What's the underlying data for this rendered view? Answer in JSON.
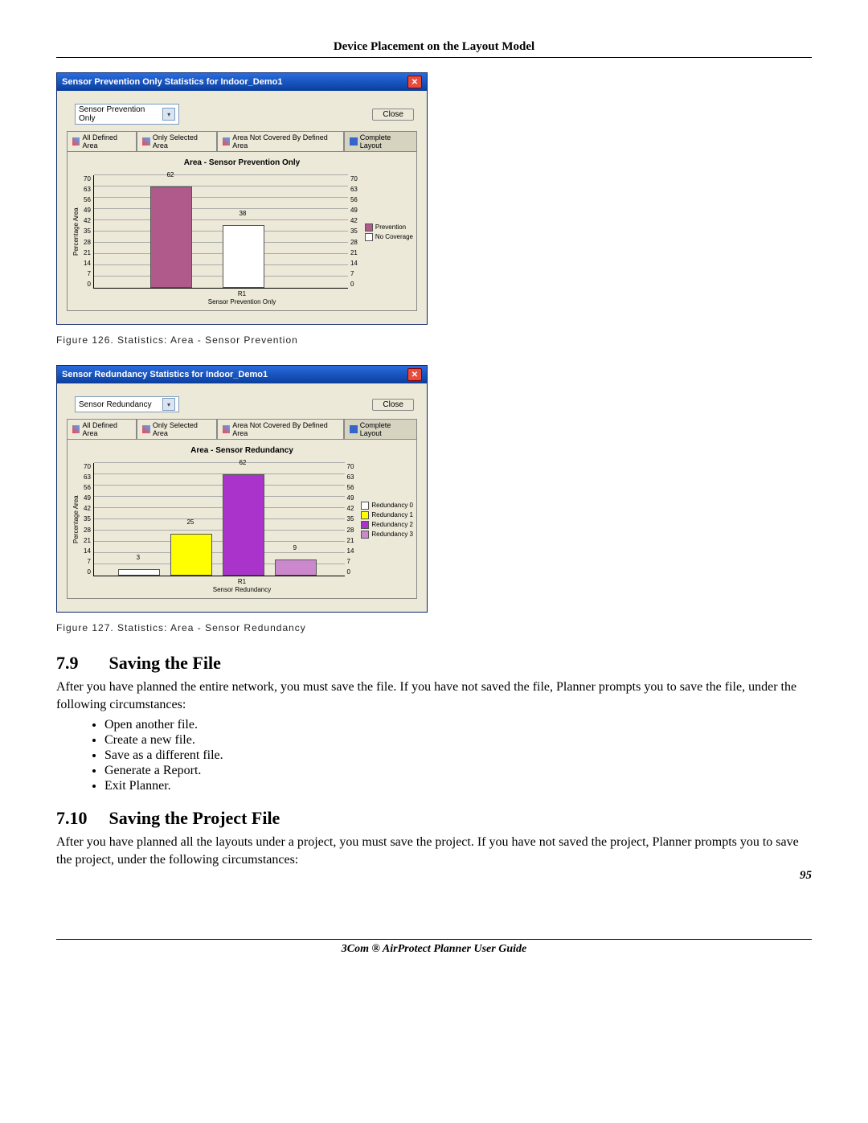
{
  "header": "Device Placement on the Layout Model",
  "chart1": {
    "windowTitle": "Sensor Prevention Only Statistics for Indoor_Demo1",
    "selectLabel": "Sensor Prevention Only",
    "closeLabel": "Close",
    "tabs": {
      "all": "All Defined Area",
      "only": "Only Selected Area",
      "notcov": "Area Not Covered By Defined Area",
      "complete": "Complete Layout"
    },
    "plotTitle": "Area - Sensor Prevention Only",
    "yAxisLabel": "Percentage Area",
    "xTick": "R1",
    "xLabel": "Sensor Prevention Only",
    "legend": {
      "a": "Prevention",
      "b": "No Coverage"
    }
  },
  "figcap1": "Figure 126.   Statistics: Area - Sensor Prevention",
  "chart2": {
    "windowTitle": "Sensor Redundancy Statistics for Indoor_Demo1",
    "selectLabel": "Sensor Redundancy",
    "closeLabel": "Close",
    "tabs": {
      "all": "All Defined Area",
      "only": "Only Selected Area",
      "notcov": "Area Not Covered By Defined Area",
      "complete": "Complete Layout"
    },
    "plotTitle": "Area - Sensor Redundancy",
    "yAxisLabel": "Percentage Area",
    "xTick": "R1",
    "xLabel": "Sensor Redundancy",
    "legend": {
      "r0": "Redundancy 0",
      "r1": "Redundancy 1",
      "r2": "Redundancy 2",
      "r3": "Redundancy 3"
    }
  },
  "figcap2": "Figure 127.   Statistics: Area - Sensor Redundancy",
  "ticks": {
    "t70": "70",
    "t63": "63",
    "t56": "56",
    "t49": "49",
    "t42": "42",
    "t35": "35",
    "t28": "28",
    "t21": "21",
    "t14": "14",
    "t7": "7",
    "t0": "0"
  },
  "chart_data": [
    {
      "type": "bar",
      "title": "Area - Sensor Prevention Only",
      "ylabel": "Percentage Area",
      "xlabel": "Sensor Prevention Only",
      "categories": [
        "R1"
      ],
      "series": [
        {
          "name": "Prevention",
          "values": [
            62
          ],
          "color": "#b05a8c"
        },
        {
          "name": "No Coverage",
          "values": [
            38
          ],
          "color": "#ffffff"
        }
      ],
      "ylim": [
        0,
        70
      ],
      "yticks": [
        0,
        7,
        14,
        21,
        28,
        35,
        42,
        49,
        56,
        63,
        70
      ]
    },
    {
      "type": "bar",
      "title": "Area - Sensor Redundancy",
      "ylabel": "Percentage Area",
      "xlabel": "Sensor Redundancy",
      "categories": [
        "R1"
      ],
      "series": [
        {
          "name": "Redundancy 0",
          "values": [
            3
          ],
          "color": "#ffffff"
        },
        {
          "name": "Redundancy 1",
          "values": [
            25
          ],
          "color": "#ffff00"
        },
        {
          "name": "Redundancy 2",
          "values": [
            62
          ],
          "color": "#aa33cc"
        },
        {
          "name": "Redundancy 3",
          "values": [
            9
          ],
          "color": "#cc88cc"
        }
      ],
      "ylim": [
        0,
        70
      ],
      "yticks": [
        0,
        7,
        14,
        21,
        28,
        35,
        42,
        49,
        56,
        63,
        70
      ]
    }
  ],
  "barlabels": {
    "c1v1": "62",
    "c1v2": "38",
    "c2v1": "3",
    "c2v2": "25",
    "c2v3": "62",
    "c2v4": "9"
  },
  "sec79": {
    "num": "7.9",
    "title": "Saving the File",
    "para": "After you have planned the entire network, you must save the file. If you have not saved the file, Planner prompts you to save the file, under the following circumstances:",
    "b1": "Open another file.",
    "b2": "Create a new file.",
    "b3": "Save as a different file.",
    "b4": "Generate a Report.",
    "b5": "Exit Planner."
  },
  "sec710": {
    "num": "7.10",
    "title": "Saving the Project File",
    "para": "After you have planned all the layouts under a project, you must save the project. If you have not saved the project, Planner prompts you to save the project, under the following circumstances:"
  },
  "footer": {
    "center": "3Com ® AirProtect Planner User Guide",
    "page": "95"
  }
}
